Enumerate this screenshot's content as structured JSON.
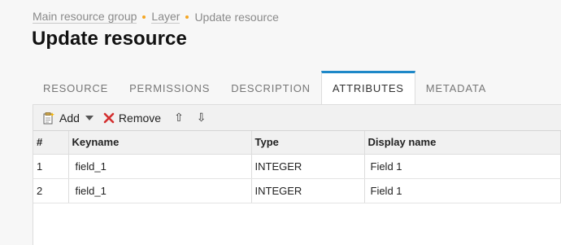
{
  "breadcrumb": {
    "items": [
      "Main resource group",
      "Layer"
    ],
    "current": "Update resource"
  },
  "page": {
    "title": "Update resource"
  },
  "tabs": [
    {
      "label": "Resource",
      "active": false
    },
    {
      "label": "Permissions",
      "active": false
    },
    {
      "label": "Description",
      "active": false
    },
    {
      "label": "Attributes",
      "active": true
    },
    {
      "label": "Metadata",
      "active": false
    }
  ],
  "toolbar": {
    "add_label": "Add",
    "remove_label": "Remove",
    "move_up_label": "⇧",
    "move_down_label": "⇩"
  },
  "table": {
    "columns": [
      "#",
      "Keyname",
      "Type",
      "Display name"
    ],
    "rows": [
      {
        "num": "1",
        "keyname": "field_1",
        "type": "INTEGER",
        "display_name": "Field 1"
      },
      {
        "num": "2",
        "keyname": "field_1",
        "type": "INTEGER",
        "display_name": "Field 1"
      }
    ]
  },
  "colors": {
    "accent": "#1e88c8",
    "breadcrumb_dot": "#f5a623",
    "remove_icon": "#d32f2f"
  }
}
